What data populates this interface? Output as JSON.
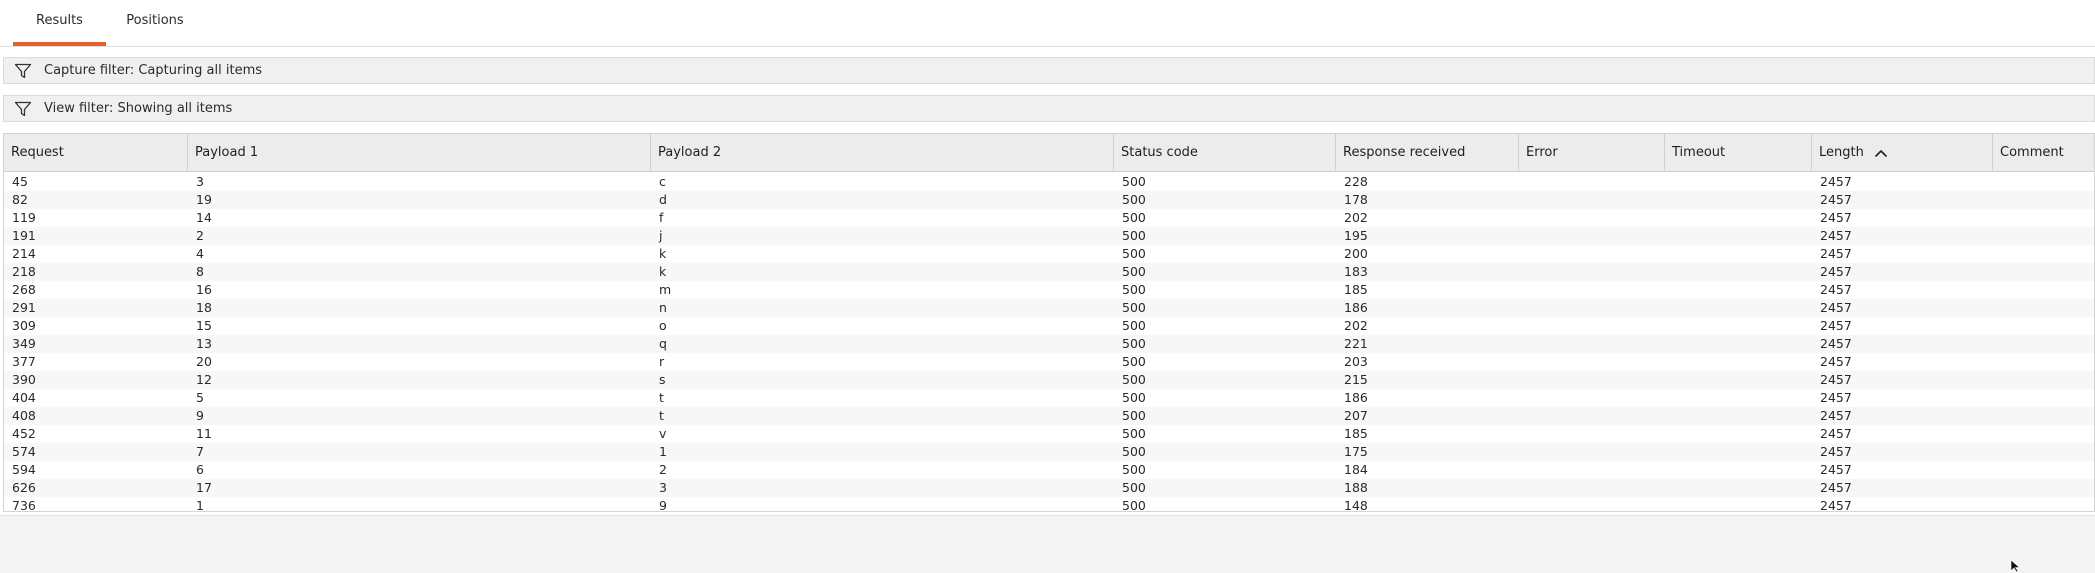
{
  "tabs": [
    {
      "label": "Results",
      "active": true
    },
    {
      "label": "Positions",
      "active": false
    }
  ],
  "capture_filter": {
    "icon": "filter-icon",
    "label": "Capture filter: Capturing all items"
  },
  "view_filter": {
    "icon": "filter-icon",
    "label": "View filter: Showing all items"
  },
  "table": {
    "columns": [
      "Request",
      "Payload 1",
      "Payload 2",
      "Status code",
      "Response received",
      "Error",
      "Timeout",
      "Length",
      "Comment"
    ],
    "sort": {
      "column": "Length",
      "direction": "ascending",
      "icon": "chevron-up-icon"
    },
    "rows": [
      [
        "45",
        "3",
        "c",
        "500",
        "228",
        "",
        "",
        "2457",
        ""
      ],
      [
        "82",
        "19",
        "d",
        "500",
        "178",
        "",
        "",
        "2457",
        ""
      ],
      [
        "119",
        "14",
        "f",
        "500",
        "202",
        "",
        "",
        "2457",
        ""
      ],
      [
        "191",
        "2",
        "j",
        "500",
        "195",
        "",
        "",
        "2457",
        ""
      ],
      [
        "214",
        "4",
        "k",
        "500",
        "200",
        "",
        "",
        "2457",
        ""
      ],
      [
        "218",
        "8",
        "k",
        "500",
        "183",
        "",
        "",
        "2457",
        ""
      ],
      [
        "268",
        "16",
        "m",
        "500",
        "185",
        "",
        "",
        "2457",
        ""
      ],
      [
        "291",
        "18",
        "n",
        "500",
        "186",
        "",
        "",
        "2457",
        ""
      ],
      [
        "309",
        "15",
        "o",
        "500",
        "202",
        "",
        "",
        "2457",
        ""
      ],
      [
        "349",
        "13",
        "q",
        "500",
        "221",
        "",
        "",
        "2457",
        ""
      ],
      [
        "377",
        "20",
        "r",
        "500",
        "203",
        "",
        "",
        "2457",
        ""
      ],
      [
        "390",
        "12",
        "s",
        "500",
        "215",
        "",
        "",
        "2457",
        ""
      ],
      [
        "404",
        "5",
        "t",
        "500",
        "186",
        "",
        "",
        "2457",
        ""
      ],
      [
        "408",
        "9",
        "t",
        "500",
        "207",
        "",
        "",
        "2457",
        ""
      ],
      [
        "452",
        "11",
        "v",
        "500",
        "185",
        "",
        "",
        "2457",
        ""
      ],
      [
        "574",
        "7",
        "1",
        "500",
        "175",
        "",
        "",
        "2457",
        ""
      ],
      [
        "594",
        "6",
        "2",
        "500",
        "184",
        "",
        "",
        "2457",
        ""
      ],
      [
        "626",
        "17",
        "3",
        "500",
        "188",
        "",
        "",
        "2457",
        ""
      ],
      [
        "736",
        "1",
        "9",
        "500",
        "148",
        "",
        "",
        "2457",
        ""
      ]
    ]
  },
  "colors": {
    "accent": "#e2602c",
    "header_bg": "#ececec",
    "filter_bg": "#f0f0f0"
  }
}
